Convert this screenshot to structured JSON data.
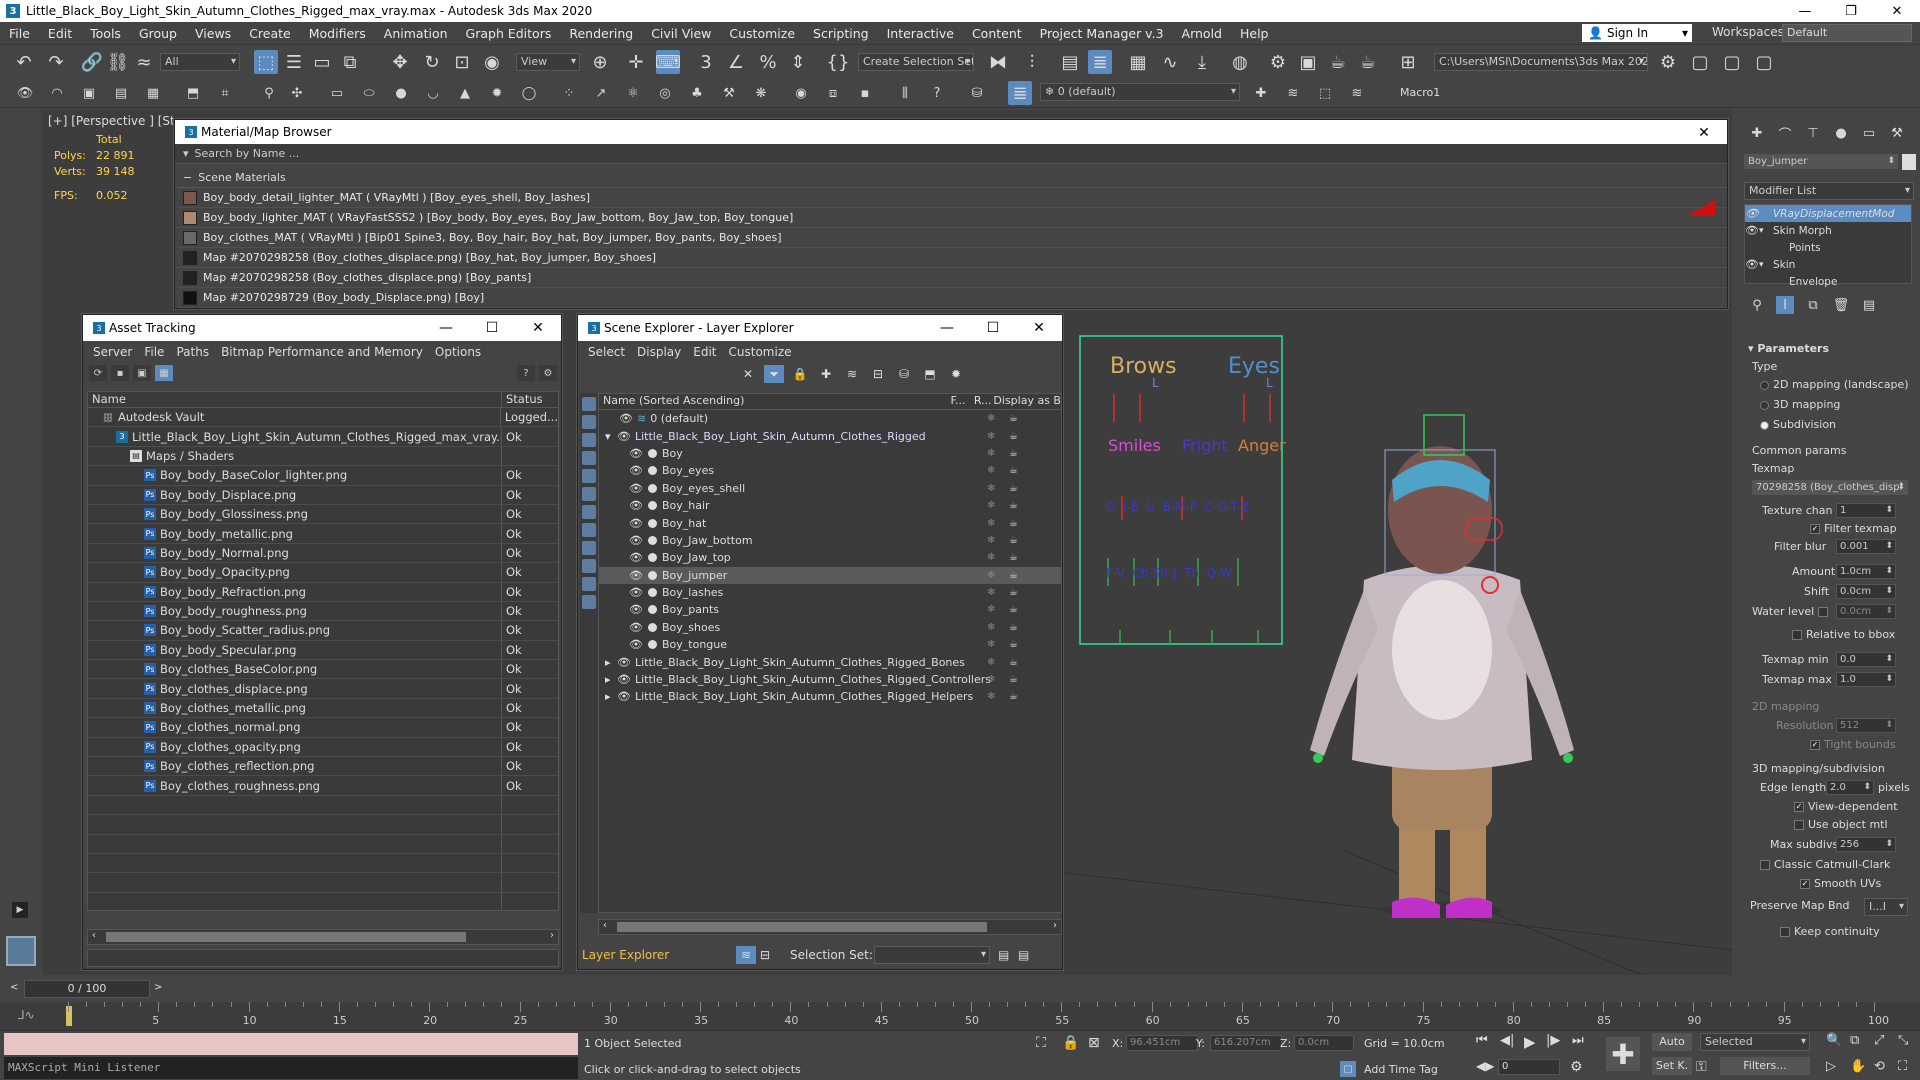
{
  "window": {
    "title": "Little_Black_Boy_Light_Skin_Autumn_Clothes_Rigged_max_vray.max - Autodesk 3ds Max 2020"
  },
  "menu": [
    "File",
    "Edit",
    "Tools",
    "Group",
    "Views",
    "Create",
    "Modifiers",
    "Animation",
    "Graph Editors",
    "Rendering",
    "Civil View",
    "Customize",
    "Scripting",
    "Interactive",
    "Content",
    "Project Manager v.3",
    "Arnold",
    "Help"
  ],
  "signin": "Sign In",
  "workspaces": {
    "label": "Workspaces:",
    "value": "Default"
  },
  "toolbar": {
    "filter": "All",
    "view": "View",
    "selset": "Create Selection Set",
    "path": "C:\\Users\\MSI\\Documents\\3ds Max 2020",
    "layer": "0 (default)",
    "macro": "Macro1"
  },
  "viewport": {
    "label": "[+] [Perspective ] [Stan",
    "total": "Total",
    "polys_label": "Polys:",
    "polys": "22 891",
    "verts_label": "Verts:",
    "verts": "39 148",
    "fps_label": "FPS:",
    "fps": "0.052"
  },
  "mmb": {
    "title": "Material/Map Browser",
    "search": "Search by Name ...",
    "section": "Scene Materials",
    "rows": [
      {
        "text": "Boy_body_detail_lighter_MAT  ( VRayMtl ) [Boy_eyes_shell, Boy_lashes]",
        "color": "#7a5a4a"
      },
      {
        "text": "Boy_body_lighter_MAT  ( VRayFastSSS2 ) [Boy_body, Boy_eyes, Boy_Jaw_bottom, Boy_Jaw_top, Boy_tongue]",
        "color": "#b08a70"
      },
      {
        "text": "Boy_clothes_MAT  ( VRayMtl ) [Bip01 Spine3, Boy, Boy_hair, Boy_hat, Boy_jumper, Boy_pants, Boy_shoes]",
        "color": "#6a6a6a"
      },
      {
        "text": "Map #2070298258 (Boy_clothes_displace.png) [Boy_hat, Boy_jumper, Boy_shoes]",
        "color": "#222222"
      },
      {
        "text": "Map #2070298258 (Boy_clothes_displace.png) [Boy_pants]",
        "color": "#222222"
      },
      {
        "text": "Map #2070298729 (Boy_body_Displace.png) [Boy]",
        "color": "#111111"
      }
    ]
  },
  "asset": {
    "title": "Asset Tracking",
    "menu": [
      "Server",
      "File",
      "Paths",
      "Bitmap Performance and Memory",
      "Options"
    ],
    "col_name": "Name",
    "col_status": "Status",
    "rows": [
      {
        "name": "Autodesk Vault",
        "status": "Logged...",
        "indent": 14,
        "icon": "vault"
      },
      {
        "name": "Little_Black_Boy_Light_Skin_Autumn_Clothes_Rigged_max_vray.max",
        "status": "Ok",
        "indent": 28,
        "icon": "max"
      },
      {
        "name": "Maps / Shaders",
        "status": "",
        "indent": 42,
        "icon": "fold"
      },
      {
        "name": "Boy_body_BaseColor_lighter.png",
        "status": "Ok",
        "indent": 56,
        "icon": "ps"
      },
      {
        "name": "Boy_body_Displace.png",
        "status": "Ok",
        "indent": 56,
        "icon": "ps"
      },
      {
        "name": "Boy_body_Glossiness.png",
        "status": "Ok",
        "indent": 56,
        "icon": "ps"
      },
      {
        "name": "Boy_body_metallic.png",
        "status": "Ok",
        "indent": 56,
        "icon": "ps"
      },
      {
        "name": "Boy_body_Normal.png",
        "status": "Ok",
        "indent": 56,
        "icon": "ps"
      },
      {
        "name": "Boy_body_Opacity.png",
        "status": "Ok",
        "indent": 56,
        "icon": "ps"
      },
      {
        "name": "Boy_body_Refraction.png",
        "status": "Ok",
        "indent": 56,
        "icon": "ps"
      },
      {
        "name": "Boy_body_roughness.png",
        "status": "Ok",
        "indent": 56,
        "icon": "ps"
      },
      {
        "name": "Boy_body_Scatter_radius.png",
        "status": "Ok",
        "indent": 56,
        "icon": "ps"
      },
      {
        "name": "Boy_body_Specular.png",
        "status": "Ok",
        "indent": 56,
        "icon": "ps"
      },
      {
        "name": "Boy_clothes_BaseColor.png",
        "status": "Ok",
        "indent": 56,
        "icon": "ps"
      },
      {
        "name": "Boy_clothes_displace.png",
        "status": "Ok",
        "indent": 56,
        "icon": "ps"
      },
      {
        "name": "Boy_clothes_metallic.png",
        "status": "Ok",
        "indent": 56,
        "icon": "ps"
      },
      {
        "name": "Boy_clothes_normal.png",
        "status": "Ok",
        "indent": 56,
        "icon": "ps"
      },
      {
        "name": "Boy_clothes_opacity.png",
        "status": "Ok",
        "indent": 56,
        "icon": "ps"
      },
      {
        "name": "Boy_clothes_reflection.png",
        "status": "Ok",
        "indent": 56,
        "icon": "ps"
      },
      {
        "name": "Boy_clothes_roughness.png",
        "status": "Ok",
        "indent": 56,
        "icon": "ps"
      }
    ]
  },
  "scene": {
    "title": "Scene Explorer - Layer Explorer",
    "menu": [
      "Select",
      "Display",
      "Edit",
      "Customize"
    ],
    "col_name": "Name (Sorted Ascending)",
    "col_f": "F...",
    "col_r": "R...",
    "col_d": "Display as B",
    "rows": [
      {
        "name": "0 (default)",
        "indent": 20,
        "type": "layer",
        "sel": false
      },
      {
        "name": "Little_Black_Boy_Light_Skin_Autumn_Clothes_Rigged",
        "indent": 6,
        "type": "parent",
        "sel": false
      },
      {
        "name": "Boy",
        "indent": 30,
        "type": "obj",
        "sel": false
      },
      {
        "name": "Boy_eyes",
        "indent": 30,
        "type": "obj",
        "sel": false
      },
      {
        "name": "Boy_eyes_shell",
        "indent": 30,
        "type": "obj",
        "sel": false
      },
      {
        "name": "Boy_hair",
        "indent": 30,
        "type": "obj",
        "sel": false
      },
      {
        "name": "Boy_hat",
        "indent": 30,
        "type": "obj",
        "sel": false
      },
      {
        "name": "Boy_Jaw_bottom",
        "indent": 30,
        "type": "obj",
        "sel": false
      },
      {
        "name": "Boy_Jaw_top",
        "indent": 30,
        "type": "obj",
        "sel": false
      },
      {
        "name": "Boy_jumper",
        "indent": 30,
        "type": "obj",
        "sel": true
      },
      {
        "name": "Boy_lashes",
        "indent": 30,
        "type": "obj",
        "sel": false
      },
      {
        "name": "Boy_pants",
        "indent": 30,
        "type": "obj",
        "sel": false
      },
      {
        "name": "Boy_shoes",
        "indent": 30,
        "type": "obj",
        "sel": false
      },
      {
        "name": "Boy_tongue",
        "indent": 30,
        "type": "obj",
        "sel": false
      },
      {
        "name": "Little_Black_Boy_Light_Skin_Autumn_Clothes_Rigged_Bones",
        "indent": 6,
        "type": "group",
        "sel": false
      },
      {
        "name": "Little_Black_Boy_Light_Skin_Autumn_Clothes_Rigged_Controllers",
        "indent": 6,
        "type": "group",
        "sel": false
      },
      {
        "name": "Little_Black_Boy_Light_Skin_Autumn_Clothes_Rigged_Helpers",
        "indent": 6,
        "type": "group",
        "sel": false
      }
    ],
    "footer": "Layer Explorer",
    "selset_label": "Selection Set:"
  },
  "facial": {
    "brows": "Brows",
    "eyes": "Eyes",
    "smiles": "Smiles",
    "fright": "Fright",
    "anger": "Anger",
    "l1": "L",
    "l2": "L",
    "row3": "O  I-E  U  B-M-P  C-G-T-Z",
    "row4": "F-V  Ch-Sh-J  Th  Q-W"
  },
  "right": {
    "objname": "Boy_jumper",
    "modlist": "Modifier List",
    "mods": [
      "VRayDisplacementMod",
      "Skin Morph",
      "Points",
      "Skin",
      "Envelope"
    ],
    "params": "Parameters",
    "type": "Type",
    "t1": "2D mapping (landscape)",
    "t2": "3D mapping",
    "t3": "Subdivision",
    "common": "Common params",
    "texmap": "Texmap",
    "texmap_val": "70298258 (Boy_clothes_displ",
    "texchan": "Texture chan",
    "texchan_val": "1",
    "filter": "Filter texmap",
    "fblur": "Filter blur",
    "fblur_val": "0.001",
    "amount": "Amount",
    "amount_val": "1.0cm",
    "shift": "Shift",
    "shift_val": "0.0cm",
    "water": "Water level",
    "water_val": "0.0cm",
    "relbbox": "Relative to bbox",
    "tmin": "Texmap min",
    "tmin_val": "0.0",
    "tmax": "Texmap max",
    "tmax_val": "1.0",
    "d2": "2D mapping",
    "res": "Resolution",
    "res_val": "512",
    "tight": "Tight bounds",
    "d3": "3D mapping/subdivision",
    "edge": "Edge length",
    "edge_val": "2.0",
    "pixels": "pixels",
    "viewdep": "View-dependent",
    "useobj": "Use object mtl",
    "maxsub": "Max subdivs",
    "maxsub_val": "256",
    "catmull": "Classic Catmull-Clark",
    "smooth": "Smooth UVs",
    "preserve": "Preserve Map Bnd",
    "preserve_val": "I...I",
    "keep": "Keep continuity"
  },
  "timeline": {
    "frame": "0 / 100",
    "ticks": [
      "5",
      "10",
      "15",
      "20",
      "25",
      "30",
      "35",
      "40",
      "45",
      "50",
      "55",
      "60",
      "65",
      "70",
      "75",
      "80",
      "85",
      "90",
      "95",
      "100"
    ]
  },
  "status": {
    "maxscript": "MAXScript Mini Listener",
    "selected": "1 Object Selected",
    "hint": "Click or click-and-drag to select objects",
    "x_label": "X:",
    "x": "96.451cm",
    "y_label": "Y:",
    "y": "616.207cm",
    "z_label": "Z:",
    "z": "0.0cm",
    "grid": "Grid = 10.0cm",
    "addtag": "Add Time Tag",
    "auto": "Auto",
    "setk": "Set K.",
    "selmode": "Selected",
    "filters": "Filters...",
    "frame": "0"
  }
}
